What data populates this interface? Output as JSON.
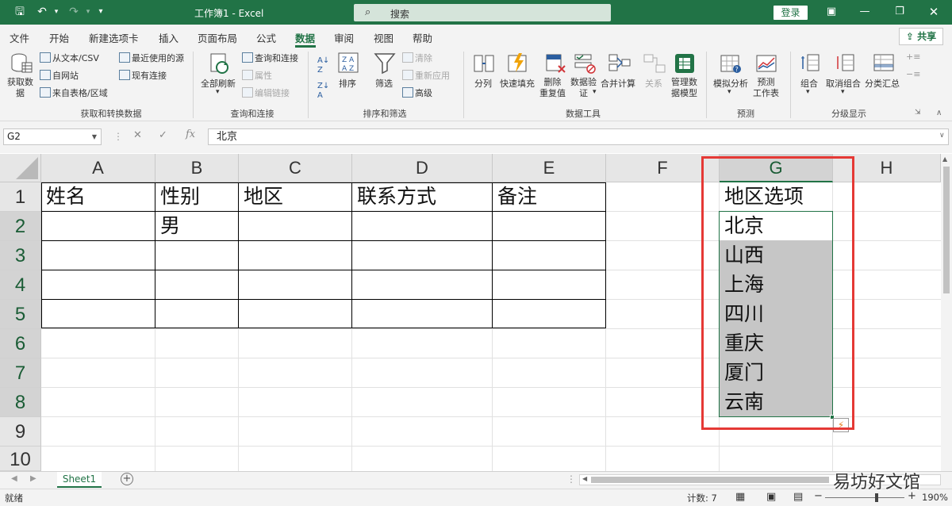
{
  "titlebar": {
    "title": "工作簿1 - Excel",
    "search_placeholder": "搜索",
    "login": "登录"
  },
  "menu": {
    "items": [
      "文件",
      "开始",
      "新建选项卡",
      "插入",
      "页面布局",
      "公式",
      "数据",
      "审阅",
      "视图",
      "帮助"
    ],
    "active": "数据",
    "share": "共享"
  },
  "ribbon": {
    "get_data": {
      "get_data_btn": "获取数\n据",
      "from_text": "从文本/CSV",
      "from_web": "自网站",
      "from_table": "来自表格/区域",
      "recent": "最近使用的源",
      "existing": "现有连接",
      "label": "获取和转换数据"
    },
    "queries": {
      "refresh_all": "全部刷新",
      "queries_conn": "查询和连接",
      "properties": "属性",
      "edit_links": "编辑链接",
      "label": "查询和连接"
    },
    "sort_filter": {
      "sort": "排序",
      "filter": "筛选",
      "clear": "清除",
      "reapply": "重新应用",
      "advanced": "高级",
      "label": "排序和筛选"
    },
    "data_tools": {
      "split": "分列",
      "flash_fill": "快速填充",
      "remove_dup": "删除\n重复值",
      "validation": "数据验\n证",
      "consolidate": "合并计算",
      "relations": "关系",
      "manage_model": "管理数\n据模型",
      "label": "数据工具"
    },
    "forecast": {
      "what_if": "模拟分析",
      "forecast_sheet": "预测\n工作表",
      "label": "预测"
    },
    "outline": {
      "group": "组合",
      "ungroup": "取消组合",
      "subtotal": "分类汇总",
      "label": "分级显示"
    }
  },
  "formula_bar": {
    "name_box": "G2",
    "fx": "fx",
    "content": "北京"
  },
  "columns": [
    "A",
    "B",
    "C",
    "D",
    "E",
    "F",
    "G",
    "H"
  ],
  "rows": [
    "1",
    "2",
    "3",
    "4",
    "5",
    "6",
    "7",
    "8",
    "9",
    "10"
  ],
  "cells": {
    "A1": "姓名",
    "B1": "性别",
    "C1": "地区",
    "D1": "联系方式",
    "E1": "备注",
    "B2": "男",
    "G1": "地区选项",
    "G2": "北京",
    "G3": "山西",
    "G4": "上海",
    "G5": "四川",
    "G6": "重庆",
    "G7": "厦门",
    "G8": "云南"
  },
  "sheet": {
    "tab": "Sheet1"
  },
  "status": {
    "ready": "就绪",
    "count": "计数: 7",
    "zoom": "190%"
  },
  "watermark": "易坊好文馆",
  "colors": {
    "accent": "#217346",
    "highlight_box": "#e53935",
    "selection_fill": "#c6c6c6"
  }
}
